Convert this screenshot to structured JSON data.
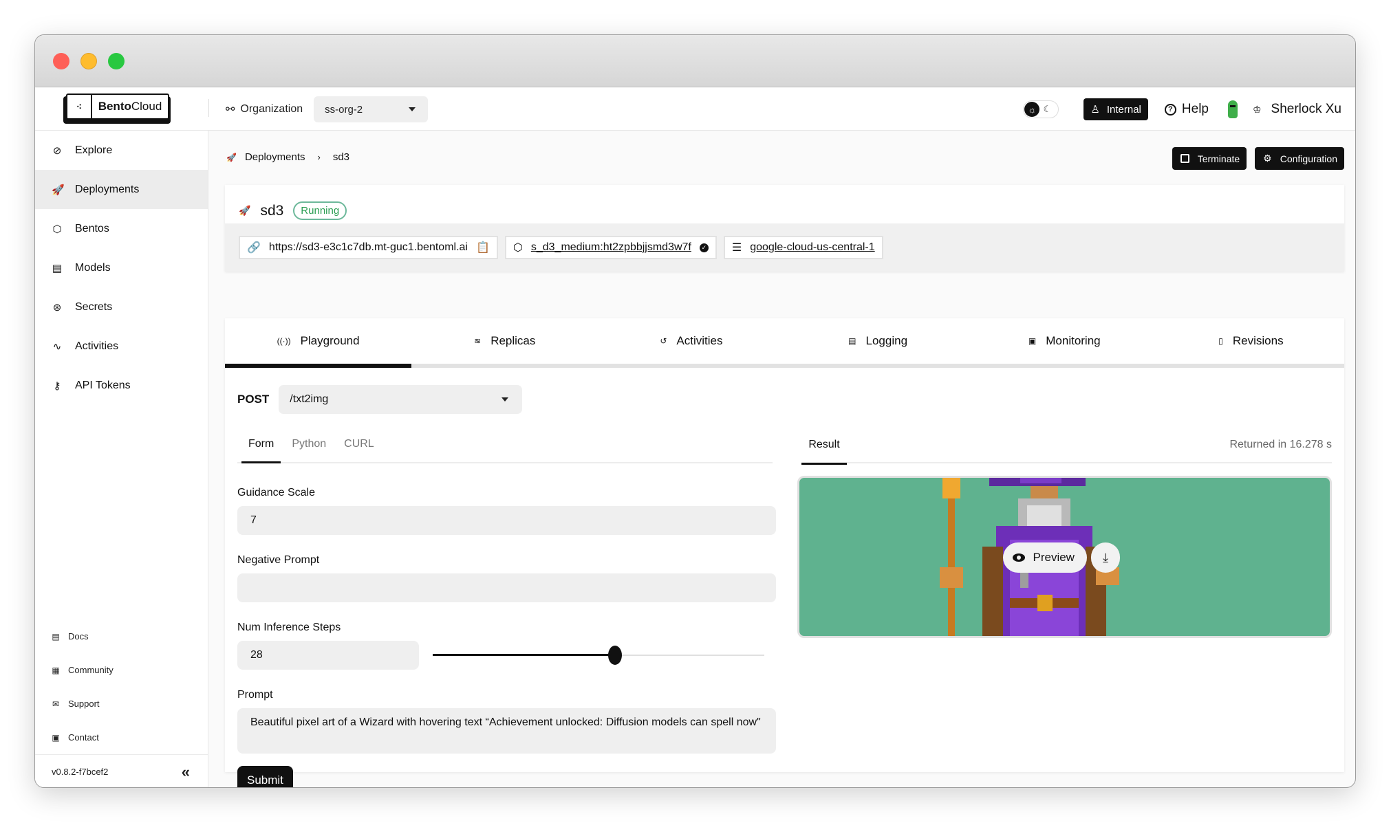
{
  "window": {
    "traffic_lights": [
      "close",
      "minimize",
      "zoom"
    ]
  },
  "header": {
    "logo": {
      "bold": "Bento",
      "regular": "Cloud"
    },
    "organization_label": "Organization",
    "organization_value": "ss-org-2",
    "theme_icons": [
      "sun-icon",
      "moon-icon"
    ],
    "internal_label": "Internal",
    "help_label": "Help",
    "user_name": "Sherlock Xu"
  },
  "sidebar": {
    "items": [
      {
        "label": "Explore",
        "icon": "compass-icon",
        "glyph": "⊘",
        "active": false
      },
      {
        "label": "Deployments",
        "icon": "rocket-icon",
        "glyph": "🚀",
        "active": true
      },
      {
        "label": "Bentos",
        "icon": "box-icon",
        "glyph": "⬡",
        "active": false
      },
      {
        "label": "Models",
        "icon": "model-file-icon",
        "glyph": "▤",
        "active": false
      },
      {
        "label": "Secrets",
        "icon": "secret-icon",
        "glyph": "⊛",
        "active": false
      },
      {
        "label": "Activities",
        "icon": "pulse-icon",
        "glyph": "∿",
        "active": false
      },
      {
        "label": "API Tokens",
        "icon": "key-icon",
        "glyph": "⚷",
        "active": false
      }
    ],
    "bottom_links": [
      {
        "label": "Docs",
        "icon": "document-icon",
        "glyph": "▤"
      },
      {
        "label": "Community",
        "icon": "community-icon",
        "glyph": "▦"
      },
      {
        "label": "Support",
        "icon": "support-icon",
        "glyph": "✉"
      },
      {
        "label": "Contact",
        "icon": "contact-icon",
        "glyph": "▣"
      }
    ],
    "version": "v0.8.2-f7bcef2",
    "collapse_glyph": "«"
  },
  "breadcrumb": {
    "parent": "Deployments",
    "separator": "›",
    "current": "sd3"
  },
  "actions": {
    "terminate_label": "Terminate",
    "configuration_label": "Configuration"
  },
  "deployment": {
    "name": "sd3",
    "status": "Running",
    "status_color": "#2a9d52",
    "url": "https://sd3-e3c1c7db.mt-guc1.bentoml.ai",
    "bento": "s_d3_medium:ht2zpbbjjsmd3w7f",
    "cluster": "google-cloud-us-central-1"
  },
  "tabs": [
    {
      "label": "Playground",
      "icon": "broadcast-icon",
      "glyph": "((·))",
      "active": true
    },
    {
      "label": "Replicas",
      "icon": "layers-icon",
      "glyph": "≋",
      "active": false
    },
    {
      "label": "Activities",
      "icon": "history-icon",
      "glyph": "↺",
      "active": false
    },
    {
      "label": "Logging",
      "icon": "log-icon",
      "glyph": "▤",
      "active": false
    },
    {
      "label": "Monitoring",
      "icon": "monitor-icon",
      "glyph": "▣",
      "active": false
    },
    {
      "label": "Revisions",
      "icon": "revisions-icon",
      "glyph": "▯",
      "active": false
    }
  ],
  "playground": {
    "method": "POST",
    "endpoint": "/txt2img",
    "input_tabs": [
      {
        "label": "Form",
        "active": true
      },
      {
        "label": "Python",
        "active": false
      },
      {
        "label": "CURL",
        "active": false
      }
    ],
    "fields": {
      "guidance_scale": {
        "label": "Guidance Scale",
        "value": "7"
      },
      "negative_prompt": {
        "label": "Negative Prompt",
        "value": ""
      },
      "num_inference_steps": {
        "label": "Num Inference Steps",
        "value": "28",
        "slider_fraction": 0.55
      },
      "prompt": {
        "label": "Prompt",
        "value": "Beautiful pixel art of a Wizard with hovering text “Achievement unlocked: Diffusion models can spell now\""
      }
    },
    "submit_label": "Submit",
    "result_tab_label": "Result",
    "returned_text": "Returned in 16.278 s",
    "preview_label": "Preview",
    "image_bg_color": "#5fb28f"
  }
}
